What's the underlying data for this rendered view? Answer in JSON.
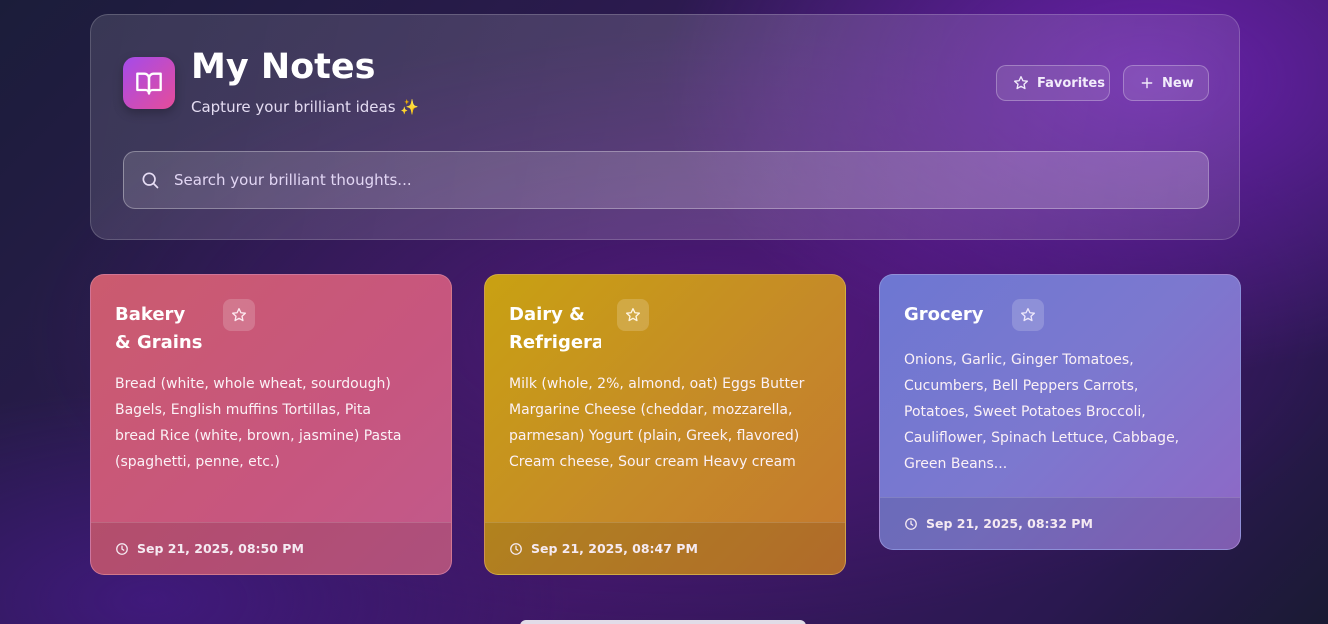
{
  "header": {
    "title": "My Notes",
    "subtitle": "Capture your brilliant ideas ✨",
    "favorites_label": "Favorites",
    "new_label": "New"
  },
  "search": {
    "placeholder": "Search your brilliant thoughts...",
    "value": ""
  },
  "notes": [
    {
      "title": "Bakery & Grains",
      "body": "Bread (white, whole wheat, sourdough) Bagels, English muffins Tortillas, Pita bread Rice (white, brown, jasmine) Pasta (spaghetti, penne, etc.)",
      "timestamp": "Sep 21, 2025, 08:50 PM",
      "color": "#c85a7c"
    },
    {
      "title": "Dairy & Refrigerated",
      "body": "Milk (whole, 2%, almond, oat) Eggs Butter Margarine Cheese (cheddar, mozzarella, parmesan) Yogurt (plain, Greek, flavored) Cream cheese, Sour cream Heavy cream",
      "timestamp": "Sep 21, 2025, 08:47 PM",
      "color": "#c79a1c"
    },
    {
      "title": "Grocery",
      "body": "Onions, Garlic, Ginger Tomatoes, Cucumbers, Bell Peppers Carrots, Potatoes, Sweet Potatoes Broccoli, Cauliflower, Spinach Lettuce, Cabbage, Green Beans...",
      "timestamp": "Sep 21, 2025, 08:32 PM",
      "color": "#7a72cf"
    }
  ],
  "icons": {
    "app": "book-open-icon",
    "favorites": "star-icon",
    "new": "plus-icon",
    "search": "search-icon",
    "note_star": "star-icon",
    "timestamp": "clock-icon"
  }
}
